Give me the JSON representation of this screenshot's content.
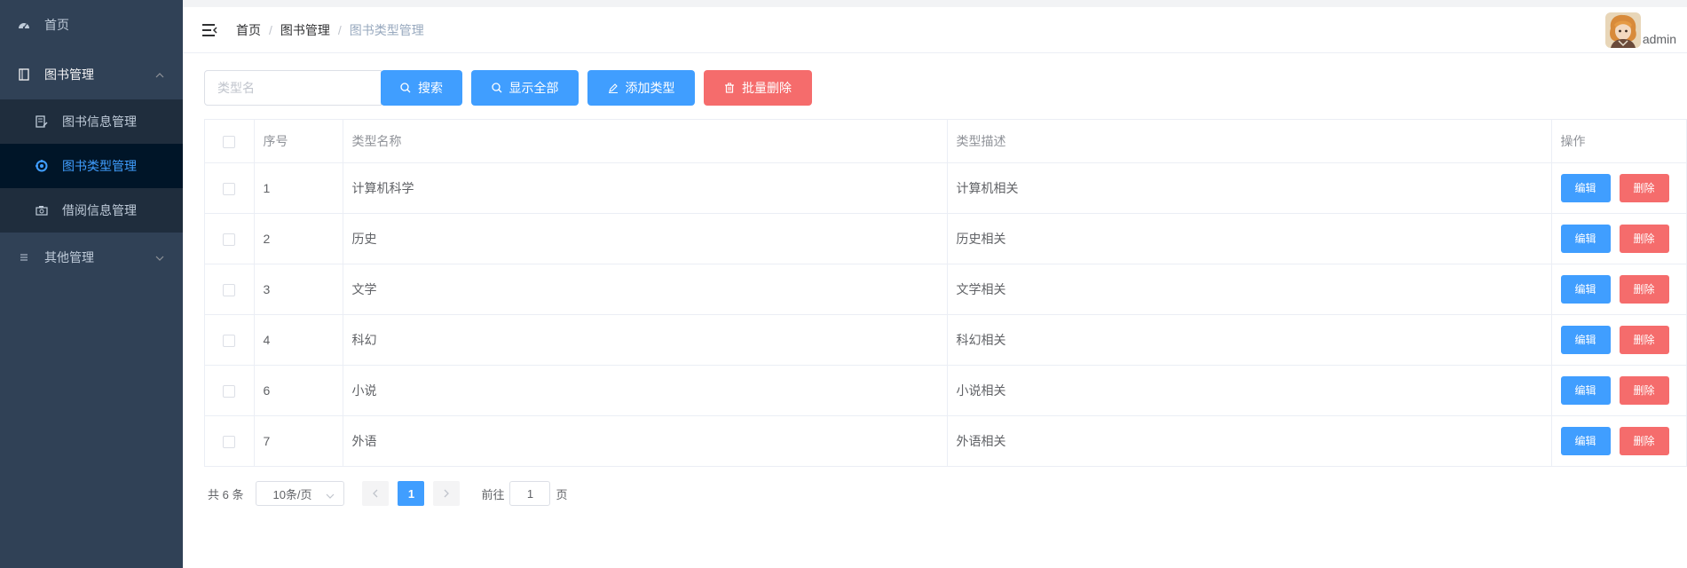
{
  "sidebar": {
    "items": [
      {
        "label": "首页",
        "icon": "dashboard-icon"
      },
      {
        "label": "图书管理",
        "icon": "book-icon",
        "expanded": true,
        "children": [
          {
            "label": "图书信息管理",
            "icon": "edit-doc-icon"
          },
          {
            "label": "图书类型管理",
            "icon": "category-icon",
            "active": true
          },
          {
            "label": "借阅信息管理",
            "icon": "camera-icon"
          }
        ]
      },
      {
        "label": "其他管理",
        "icon": "list-icon",
        "expanded": false
      }
    ]
  },
  "header": {
    "breadcrumb": [
      "首页",
      "图书管理",
      "图书类型管理"
    ],
    "user": "admin"
  },
  "toolbar": {
    "search_placeholder": "类型名",
    "search_label": "搜索",
    "show_all_label": "显示全部",
    "add_label": "添加类型",
    "batch_delete_label": "批量删除"
  },
  "table": {
    "headers": {
      "no": "序号",
      "name": "类型名称",
      "desc": "类型描述",
      "ops": "操作"
    },
    "edit_label": "编辑",
    "delete_label": "删除",
    "rows": [
      {
        "no": "1",
        "name": "计算机科学",
        "desc": "计算机相关"
      },
      {
        "no": "2",
        "name": "历史",
        "desc": "历史相关"
      },
      {
        "no": "3",
        "name": "文学",
        "desc": "文学相关"
      },
      {
        "no": "4",
        "name": "科幻",
        "desc": "科幻相关"
      },
      {
        "no": "6",
        "name": "小说",
        "desc": "小说相关"
      },
      {
        "no": "7",
        "name": "外语",
        "desc": "外语相关"
      }
    ]
  },
  "pagination": {
    "total": "共 6 条",
    "page_size": "10条/页",
    "current_page": "1",
    "goto_prefix": "前往",
    "goto_value": "1",
    "goto_suffix": "页"
  },
  "colors": {
    "sidebar_bg": "#304156",
    "primary": "#409eff",
    "danger": "#f56c6c"
  }
}
